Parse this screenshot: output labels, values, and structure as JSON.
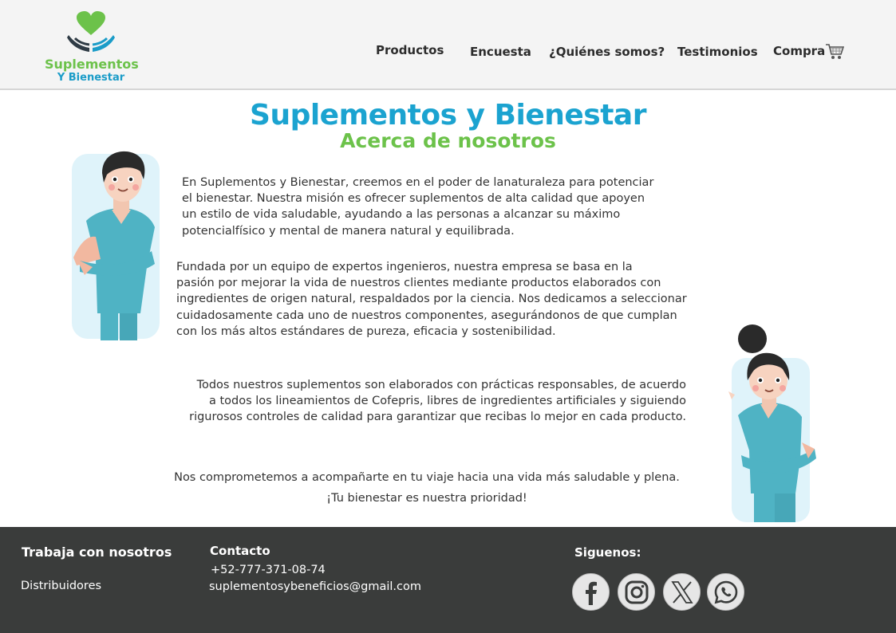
{
  "header": {
    "logo_line1": "Suplementos",
    "logo_line2": "Y Bienestar",
    "nav": [
      "Productos",
      "Encuesta",
      "¿Quiénes somos?",
      "Testimonios",
      "Compra"
    ]
  },
  "main": {
    "title": "Suplementos y Bienestar",
    "subtitle": "Acerca de nosotros",
    "p1": [
      "En Suplementos y Bienestar, creemos en el poder de lanaturaleza para potenciar",
      "el bienestar. Nuestra misión es ofrecer suplementos de alta calidad que apoyen",
      "un estilo de vida saludable, ayudando a las personas a alcanzar su máximo",
      "potencialfísico y mental de manera natural y equilibrada."
    ],
    "p2": [
      "Fundada por un equipo de expertos ingenieros, nuestra empresa se basa en la",
      "pasión por mejorar la vida de nuestros clientes mediante productos elaborados con",
      "ingredientes de origen natural, respaldados por la ciencia. Nos dedicamos a seleccionar",
      "cuidadosamente cada uno de nuestros componentes, asegurándonos de que cumplan",
      "con los más altos estándares de pureza, eficacia y sostenibilidad."
    ],
    "p3": [
      "Todos nuestros suplementos son elaborados con prácticas responsables, de acuerdo",
      "a todos los lineamientos de Cofepris, libres de ingredientes artificiales y siguiendo",
      "rigurosos controles de calidad para garantizar que recibas lo mejor en cada producto."
    ],
    "p4": [
      "Nos comprometemos a acompañarte en tu viaje hacia una vida más saludable y plena.",
      "¡Tu bienestar es nuestra prioridad!"
    ]
  },
  "footer": {
    "work_heading": "Trabaja con nosotros",
    "distributors": "Distribuidores",
    "contact_heading": "Contacto",
    "phone": "+52-777-371-08-74",
    "email": "suplementosybeneficios@gmail.com",
    "follow_heading": "Siguenos:",
    "social_icons": [
      "facebook-icon",
      "instagram-icon",
      "x-icon",
      "whatsapp-icon"
    ]
  },
  "colors": {
    "brand_blue": "#1ba3d0",
    "brand_green": "#6cc24a",
    "footer_bg": "#3a3c3b",
    "scrub_teal": "#4fb3c4"
  }
}
